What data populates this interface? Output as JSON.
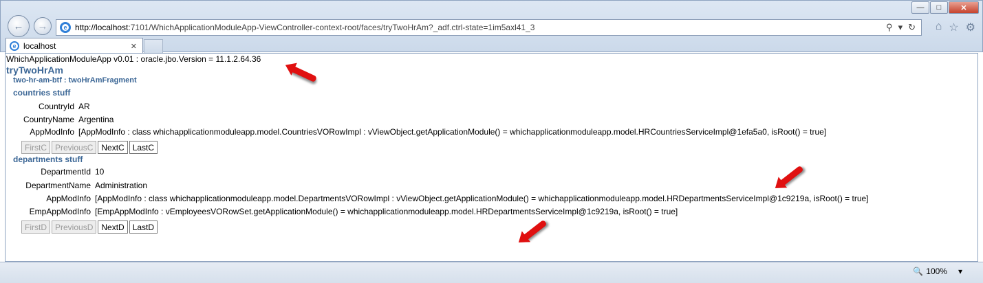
{
  "browser": {
    "url_host": "http://localhost",
    "url_rest": ":7101/WhichApplicationModuleApp-ViewController-context-root/faces/tryTwoHrAm?_adf.ctrl-state=1im5axl41_3",
    "tab_title": "localhost",
    "ie_glyph": "e",
    "zoom": "100%"
  },
  "page": {
    "version": "WhichApplicationModuleApp v0.01 : oracle.jbo.Version = 11.1.2.64.36",
    "title": "tryTwoHrAm",
    "region": "two-hr-am-btf : twoHrAmFragment"
  },
  "countries": {
    "heading": "countries stuff",
    "rows": [
      {
        "label": "CountryId",
        "value": "AR"
      },
      {
        "label": "CountryName",
        "value": "Argentina"
      },
      {
        "label": "AppModInfo",
        "value": "[AppModInfo : class whichapplicationmoduleapp.model.CountriesVORowImpl : vViewObject.getApplicationModule() = whichapplicationmoduleapp.model.HRCountriesServiceImpl@1efa5a0, isRoot() = true]"
      }
    ],
    "buttons": [
      "FirstC",
      "PreviousC",
      "NextC",
      "LastC"
    ]
  },
  "departments": {
    "heading": "departments stuff",
    "rows": [
      {
        "label": "DepartmentId",
        "value": "10"
      },
      {
        "label": "DepartmentName",
        "value": "Administration"
      },
      {
        "label": "AppModInfo",
        "value": "[AppModInfo : class whichapplicationmoduleapp.model.DepartmentsVORowImpl : vViewObject.getApplicationModule() = whichapplicationmoduleapp.model.HRDepartmentsServiceImpl@1c9219a, isRoot() = true]"
      },
      {
        "label": "EmpAppModInfo",
        "value": "[EmpAppModInfo : vEmployeesVORowSet.getApplicationModule() = whichapplicationmoduleapp.model.HRDepartmentsServiceImpl@1c9219a, isRoot() = true]"
      }
    ],
    "buttons": [
      "FirstD",
      "PreviousD",
      "NextD",
      "LastD"
    ]
  },
  "colors": {
    "heading": "#3c6796",
    "arrow": "#e01010"
  }
}
